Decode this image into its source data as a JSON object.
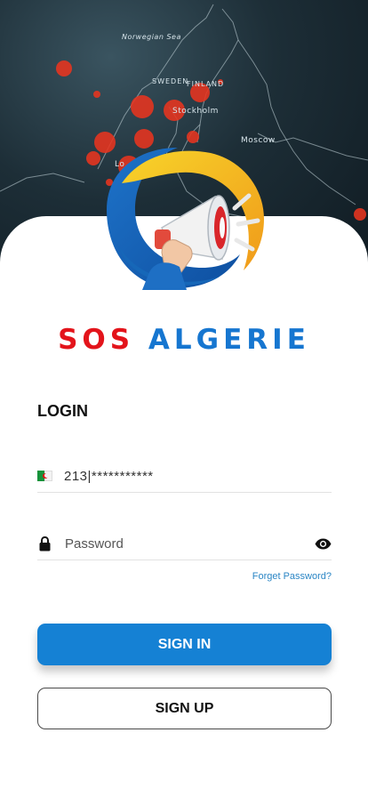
{
  "map": {
    "labels": {
      "sea": "Norwegian Sea",
      "sweden": "SWEDEN",
      "finland": "FINLAND",
      "stockholm": "Stockholm",
      "moscow": "Moscow",
      "london": "Lo"
    }
  },
  "brand": {
    "part1": "SOS",
    "part2": "ALGERIE",
    "colors": {
      "red": "#e3141b",
      "blue": "#1676d0"
    }
  },
  "login": {
    "title": "LOGIN",
    "phone": {
      "flag_icon": "algeria-flag-icon",
      "value": "213|***********"
    },
    "password": {
      "icon": "lock-icon",
      "placeholder": "Password",
      "toggle_icon": "eye-icon"
    },
    "forgot_label": "Forget Password?",
    "signin_label": "SIGN IN",
    "signup_label": "SIGN UP"
  },
  "colors": {
    "accent": "#1581d4",
    "link": "#2b86c5"
  }
}
